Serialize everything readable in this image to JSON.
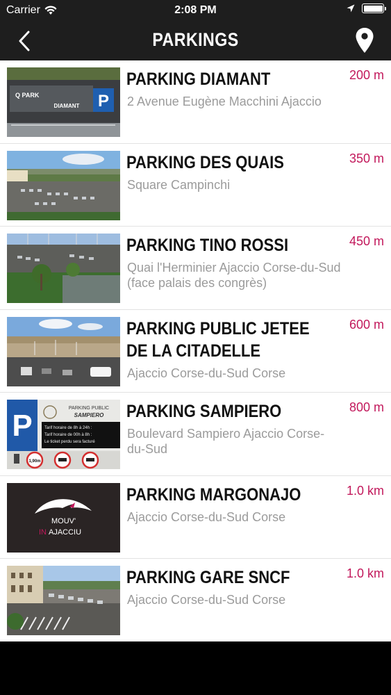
{
  "status_bar": {
    "carrier": "Carrier",
    "time": "2:08 PM",
    "battery_level": 1.0
  },
  "nav": {
    "title": "PARKINGS",
    "back_icon": "chevron-left-icon",
    "map_icon": "map-pin-icon"
  },
  "colors": {
    "bar_bg": "#1e1e1e",
    "distance": "#c2185b",
    "address": "#9b9b9b"
  },
  "parkings": [
    {
      "name": "PARKING DIAMANT",
      "address": "2 Avenue Eugène Macchini Ajaccio",
      "distance": "200 m"
    },
    {
      "name": "PARKING DES QUAIS",
      "address": "Square Campinchi",
      "distance": "350 m"
    },
    {
      "name": "PARKING TINO ROSSI",
      "address": "Quai l'Herminier Ajaccio Corse-du-Sud (face palais des congrès)",
      "distance": "450 m"
    },
    {
      "name": "PARKING PUBLIC JETEE DE LA CITADELLE",
      "address": "Ajaccio Corse-du-Sud Corse",
      "distance": "600 m"
    },
    {
      "name": "PARKING SAMPIERO",
      "address": "Boulevard Sampiero Ajaccio Corse-du-Sud",
      "distance": "800 m"
    },
    {
      "name": "PARKING MARGONAJO",
      "address": "Ajaccio Corse-du-Sud Corse",
      "distance": "1.0 km"
    },
    {
      "name": "PARKING GARE SNCF",
      "address": "Ajaccio Corse-du-Sud Corse",
      "distance": "1.0 km"
    }
  ],
  "thumb_texts": {
    "diamant_brand": "Q PARK",
    "diamant_sign": "DIAMANT",
    "diamant_p": "P",
    "sampiero_p": "P",
    "sampiero_header": "PARKING PUBLIC",
    "sampiero_name": "SAMPIERO",
    "sampiero_line1": "Tarif horaire de 8h à 24h :",
    "sampiero_line2": "Tarif horaire de 00h à 8h :",
    "sampiero_line3": "Le ticket perdu sera facturé",
    "sampiero_height": "1,90m",
    "margonajo_logo_1": "MOUV'",
    "margonajo_logo_in": "IN",
    "margonajo_logo_2": "AJACCIU"
  }
}
